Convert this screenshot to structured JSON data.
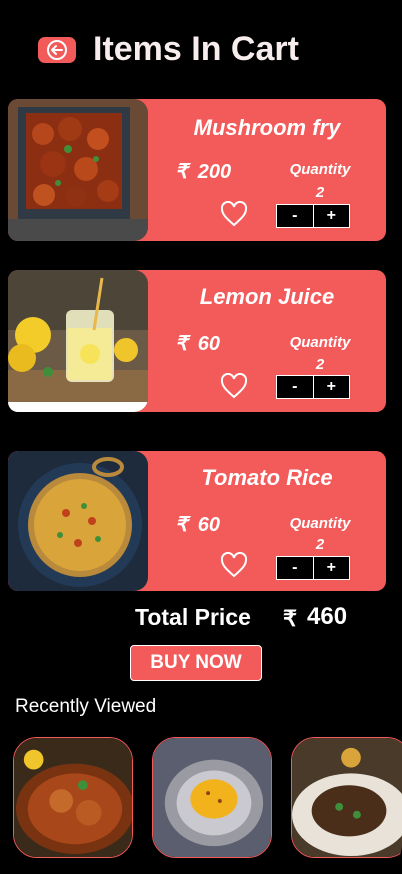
{
  "header": {
    "title": "Items In Cart",
    "back_icon": "arrow-left-icon"
  },
  "cart": {
    "currency": "₹",
    "items": [
      {
        "name": "Mushroom fry",
        "price": "200",
        "quantity_label": "Quantity",
        "quantity": "2",
        "minus": "-",
        "plus": "+"
      },
      {
        "name": "Lemon Juice",
        "price": "60",
        "quantity_label": "Quantity",
        "quantity": "2",
        "minus": "-",
        "plus": "+"
      },
      {
        "name": "Tomato Rice",
        "price": "60",
        "quantity_label": "Quantity",
        "quantity": "2",
        "minus": "-",
        "plus": "+"
      }
    ]
  },
  "summary": {
    "total_label": "Total Price",
    "currency": "₹",
    "total_value": "460"
  },
  "actions": {
    "buy_now": "BUY NOW"
  },
  "recent": {
    "title": "Recently Viewed"
  },
  "colors": {
    "accent": "#f35a5a",
    "background": "#000000",
    "text": "#ffffff"
  }
}
